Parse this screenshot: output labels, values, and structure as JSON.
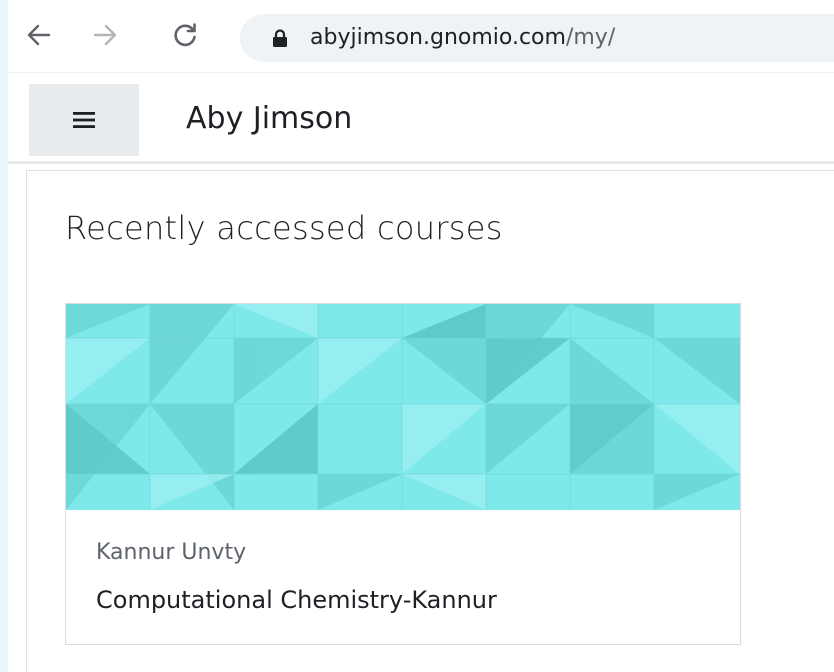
{
  "browser": {
    "url_host": "abyjimson.gnomio.com",
    "url_path": "/my/",
    "back_icon": "arrow-left-icon",
    "forward_icon": "arrow-right-icon",
    "reload_icon": "reload-icon",
    "lock_icon": "lock-icon"
  },
  "header": {
    "menu_icon": "hamburger-menu-icon",
    "site_title": "Aby Jimson"
  },
  "main": {
    "block_title": "Recently accessed courses",
    "courses": [
      {
        "category": "Kannur Unvty",
        "name": "Computational Chemistry-Kannur",
        "image_color": "#7ee8ea"
      }
    ]
  }
}
